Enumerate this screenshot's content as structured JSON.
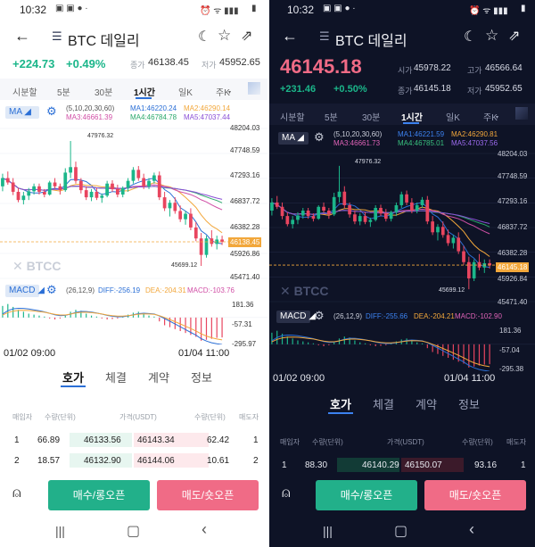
{
  "light": {
    "status": {
      "time": "10:32",
      "battery": "▮"
    },
    "header": {
      "title": "BTC 데일리"
    },
    "summary": {
      "change": "+224.73",
      "change_pct": "+0.49%",
      "close_label": "종가",
      "close": "46138.45",
      "low_label": "저가",
      "low": "45952.65"
    },
    "tabs": [
      "시분할",
      "5분",
      "30분",
      "1시간",
      "일K",
      "주K"
    ],
    "active_tab": "1시간",
    "ma": {
      "label": "MA",
      "params": "(5,10,20,30,60)",
      "ma1": "MA1:46220.24",
      "ma2": "MA2:46290.14",
      "ma3": "MA3:46661.39",
      "ma4": "MA4:46784.78",
      "ma5": "MA5:47037.44"
    },
    "yaxis": [
      "48204.03",
      "47748.59",
      "47293.16",
      "46837.72",
      "46382.28",
      "46138.45",
      "45926.86",
      "45471.40"
    ],
    "annotations": {
      "high": "47976.32",
      "low": "45699.12"
    },
    "watermark": "BTCC",
    "macd": {
      "label": "MACD",
      "params": "(26,12,9)",
      "diff": "DIFF:-256.19",
      "dea": "DEA:-204.31",
      "macd": "MACD:-103.76",
      "y_top": "181.36",
      "y_mid": "-57.31",
      "y_bot": "-295.97"
    },
    "xaxis": {
      "left": "01/02 09:00",
      "right": "01/04 11:00"
    },
    "book_tabs": [
      "호가",
      "체결",
      "계약",
      "정보"
    ],
    "book_header": {
      "buyer": "매입자",
      "qty_left": "수량(단위)",
      "price": "가격(USDT)",
      "qty_right": "수량(단위)",
      "seller": "매도자"
    },
    "book_rows": [
      {
        "idx": "1",
        "qty_buy": "66.89",
        "bid": "46133.56",
        "ask": "46143.34",
        "qty_sell": "62.42",
        "seller": "1"
      },
      {
        "idx": "2",
        "qty_buy": "18.57",
        "bid": "46132.90",
        "ask": "46144.06",
        "qty_sell": "10.61",
        "seller": "2"
      }
    ],
    "buttons": {
      "buy": "매수/롱오픈",
      "sell": "매도/숏오픈"
    }
  },
  "dark": {
    "status": {
      "time": "10:32"
    },
    "header": {
      "title": "BTC 데일리"
    },
    "summary": {
      "price": "46145.18",
      "change": "+231.46",
      "change_pct": "+0.50%",
      "open_label": "시가",
      "open": "45978.22",
      "high_label": "고가",
      "high": "46566.64",
      "close_label": "종가",
      "close": "46145.18",
      "low_label": "저가",
      "low": "45952.65"
    },
    "tabs": [
      "시분할",
      "5분",
      "30분",
      "1시간",
      "일K",
      "주K"
    ],
    "active_tab": "1시간",
    "ma": {
      "label": "MA",
      "params": "(5,10,20,30,60)",
      "ma1": "MA1:46221.59",
      "ma2": "MA2:46290.81",
      "ma3": "MA3:46661.73",
      "ma4": "MA4:46785.01",
      "ma5": "MA5:47037.56"
    },
    "yaxis": [
      "48204.03",
      "47748.59",
      "47293.16",
      "46837.72",
      "46382.28",
      "46145.18",
      "45926.84",
      "45471.40"
    ],
    "annotations": {
      "high": "47976.32",
      "low": "45699.12"
    },
    "watermark": "BTCC",
    "macd": {
      "label": "MACD",
      "params": "(26,12,9)",
      "diff": "DIFF:-255.66",
      "dea": "DEA:-204.21",
      "macd": "MACD:-102.90",
      "y_top": "181.36",
      "y_mid": "-57.04",
      "y_bot": "-295.38"
    },
    "xaxis": {
      "left": "01/02 09:00",
      "right": "01/04 11:00"
    },
    "book_tabs": [
      "호가",
      "체결",
      "계약",
      "정보"
    ],
    "book_header": {
      "buyer": "매입자",
      "qty_left": "수량(단위)",
      "price": "가격(USDT)",
      "qty_right": "수량(단위)",
      "seller": "매도자"
    },
    "book_rows": [
      {
        "idx": "1",
        "qty_buy": "88.30",
        "bid": "46140.29",
        "ask": "46150.07",
        "qty_sell": "93.16",
        "seller": "1"
      }
    ],
    "buttons": {
      "buy": "매수/롱오픈",
      "sell": "매도/숏오픈"
    }
  },
  "colors": {
    "up": "#1bb68a",
    "down": "#e8455f",
    "accent": "#f2a73b",
    "ma1": "#2b6fd6",
    "ma2": "#f2a73b",
    "ma3": "#d14fa6",
    "ma4": "#2aa86a",
    "ma5": "#8a4fd6"
  },
  "candles": [
    [
      47150,
      47380,
      47060,
      47300
    ],
    [
      47300,
      47420,
      47180,
      47220
    ],
    [
      47220,
      47300,
      46990,
      47050
    ],
    [
      47050,
      47120,
      46860,
      46900
    ],
    [
      46900,
      47050,
      46820,
      46980
    ],
    [
      46980,
      47120,
      46900,
      47060
    ],
    [
      47060,
      47200,
      47000,
      47150
    ],
    [
      47150,
      47200,
      47000,
      47050
    ],
    [
      47050,
      47100,
      46950,
      47000
    ],
    [
      47000,
      47250,
      46980,
      47220
    ],
    [
      47220,
      47300,
      47100,
      47150
    ],
    [
      47150,
      47200,
      47000,
      47080
    ],
    [
      47080,
      47480,
      47050,
      47400
    ],
    [
      47400,
      47976,
      47300,
      47500
    ],
    [
      47500,
      47600,
      47200,
      47250
    ],
    [
      47250,
      47300,
      47020,
      47080
    ],
    [
      47080,
      47150,
      46900,
      46950
    ],
    [
      46950,
      47100,
      46880,
      47050
    ],
    [
      47050,
      47120,
      46900,
      46940
    ],
    [
      46940,
      47020,
      46850,
      46980
    ],
    [
      46980,
      47250,
      46950,
      47200
    ],
    [
      47200,
      47260,
      47050,
      47100
    ],
    [
      47100,
      47180,
      46950,
      47000
    ],
    [
      47000,
      47150,
      46950,
      47120
    ],
    [
      47120,
      47300,
      47050,
      47250
    ],
    [
      47250,
      47500,
      47200,
      47450
    ],
    [
      47450,
      47520,
      47250,
      47300
    ],
    [
      47300,
      47380,
      47100,
      47150
    ],
    [
      47150,
      47300,
      47100,
      47250
    ],
    [
      47250,
      47400,
      47200,
      47350
    ],
    [
      47350,
      47420,
      46900,
      46950
    ],
    [
      46950,
      47050,
      46700,
      46750
    ],
    [
      46750,
      46900,
      46600,
      46850
    ],
    [
      46850,
      46950,
      46650,
      46700
    ],
    [
      46700,
      46800,
      46500,
      46550
    ],
    [
      46550,
      46700,
      46450,
      46650
    ],
    [
      46650,
      46750,
      46350,
      46400
    ],
    [
      46400,
      46500,
      46150,
      46200
    ],
    [
      46200,
      46300,
      45699,
      45900
    ],
    [
      45900,
      46250,
      45850,
      46200
    ],
    [
      46200,
      46350,
      46050,
      46100
    ],
    [
      46100,
      46250,
      46000,
      46180
    ],
    [
      46180,
      46250,
      46080,
      46140
    ]
  ],
  "macd_bars": [
    60,
    70,
    55,
    40,
    30,
    20,
    15,
    10,
    5,
    -5,
    -10,
    -5,
    10,
    30,
    40,
    35,
    20,
    10,
    5,
    -5,
    -10,
    -8,
    -5,
    5,
    15,
    25,
    30,
    20,
    10,
    5,
    -20,
    -40,
    -50,
    -60,
    -70,
    -80,
    -90,
    -100,
    -120,
    -115,
    -110,
    -105,
    -103
  ]
}
